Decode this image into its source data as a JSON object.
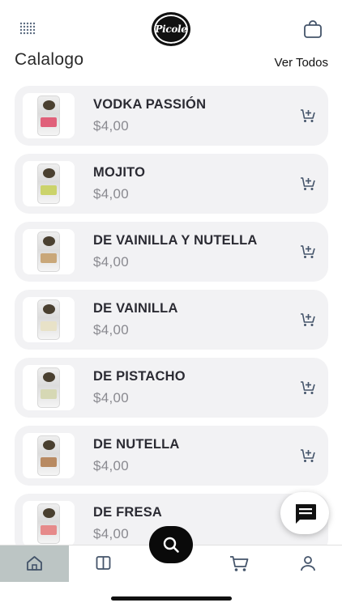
{
  "header": {
    "logo_text": "Picole",
    "menu_icon": "grid-dots-icon",
    "bag_icon": "shopping-bag-icon"
  },
  "catalog": {
    "title": "Calalogo",
    "see_all_label": "Ver Todos"
  },
  "products": [
    {
      "name": "VODKA PASSIÓN",
      "price": "$4,00",
      "band_color": "#e0607a"
    },
    {
      "name": "MOJITO",
      "price": "$4,00",
      "band_color": "#cbd36a"
    },
    {
      "name": "DE VAINILLA Y NUTELLA",
      "price": "$4,00",
      "band_color": "#c9a779"
    },
    {
      "name": "DE VAINILLA",
      "price": "$4,00",
      "band_color": "#e8e2c8"
    },
    {
      "name": "DE PISTACHO",
      "price": "$4,00",
      "band_color": "#d6d8b4"
    },
    {
      "name": "DE NUTELLA",
      "price": "$4,00",
      "band_color": "#b88a62"
    },
    {
      "name": "DE FRESA",
      "price": "$4,00",
      "band_color": "#e68a8a"
    }
  ],
  "fab": {
    "chat_icon": "chat-icon",
    "search_icon": "search-icon"
  },
  "tabbar": {
    "items": [
      {
        "icon": "home-icon",
        "active": true
      },
      {
        "icon": "book-icon",
        "active": false
      },
      {
        "icon": "cart-icon",
        "active": false
      },
      {
        "icon": "user-icon",
        "active": false
      }
    ]
  },
  "colors": {
    "card_bg": "#f2f2f4",
    "active_tab": "#bcc5c4",
    "price": "#8a8a90",
    "icon": "#44546a"
  }
}
